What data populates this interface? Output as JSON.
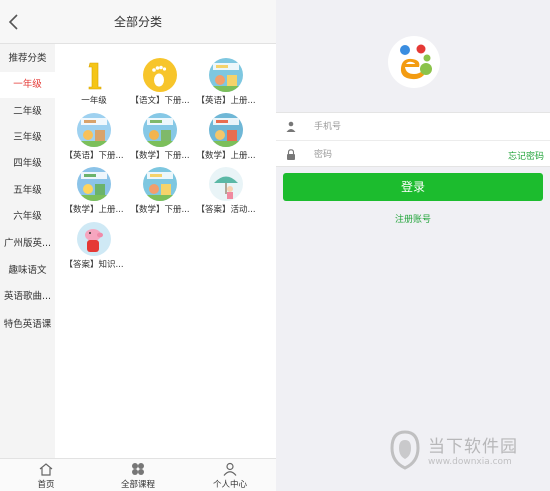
{
  "left_header": {
    "title": "全部分类"
  },
  "sidebar": {
    "items": [
      {
        "label": "推荐分类"
      },
      {
        "label": "一年级"
      },
      {
        "label": "二年级"
      },
      {
        "label": "三年级"
      },
      {
        "label": "四年级"
      },
      {
        "label": "五年级"
      },
      {
        "label": "六年级"
      },
      {
        "label": "广州版英..."
      },
      {
        "label": "趣味语文"
      },
      {
        "label": "英语歌曲..."
      },
      {
        "label": "特色英语课"
      }
    ],
    "active_index": 1
  },
  "grid": {
    "items": [
      {
        "label": "一年级",
        "icon": "number-one-icon"
      },
      {
        "label": "【语文】下册...",
        "icon": "footprint-icon"
      },
      {
        "label": "【英语】上册...",
        "icon": "book-cover-icon"
      },
      {
        "label": "【英语】下册...",
        "icon": "book-cover-icon"
      },
      {
        "label": "【数学】下册...",
        "icon": "book-cover-icon"
      },
      {
        "label": "【数学】上册...",
        "icon": "book-cover-icon"
      },
      {
        "label": "【数学】上册...",
        "icon": "book-cover-icon"
      },
      {
        "label": "【数学】下册...",
        "icon": "book-cover-icon"
      },
      {
        "label": "【答案】活动...",
        "icon": "umbrella-girl-icon"
      },
      {
        "label": "【答案】知识...",
        "icon": "pig-cartoon-icon"
      }
    ]
  },
  "tabbar": {
    "tabs": [
      {
        "label": "首页",
        "icon": "home-icon"
      },
      {
        "label": "全部课程",
        "icon": "clover-icon"
      },
      {
        "label": "个人中心",
        "icon": "person-icon"
      }
    ]
  },
  "login": {
    "phone_placeholder": "手机号",
    "password_placeholder": "密码",
    "forgot_label": "忘记密码",
    "login_label": "登录",
    "register_label": "注册账号"
  },
  "watermark": {
    "name": "当下软件园",
    "url": "www.downxia.com"
  },
  "colors": {
    "accent_green": "#1cbc2e",
    "link_green": "#22a43a",
    "active_red": "#e53935"
  }
}
